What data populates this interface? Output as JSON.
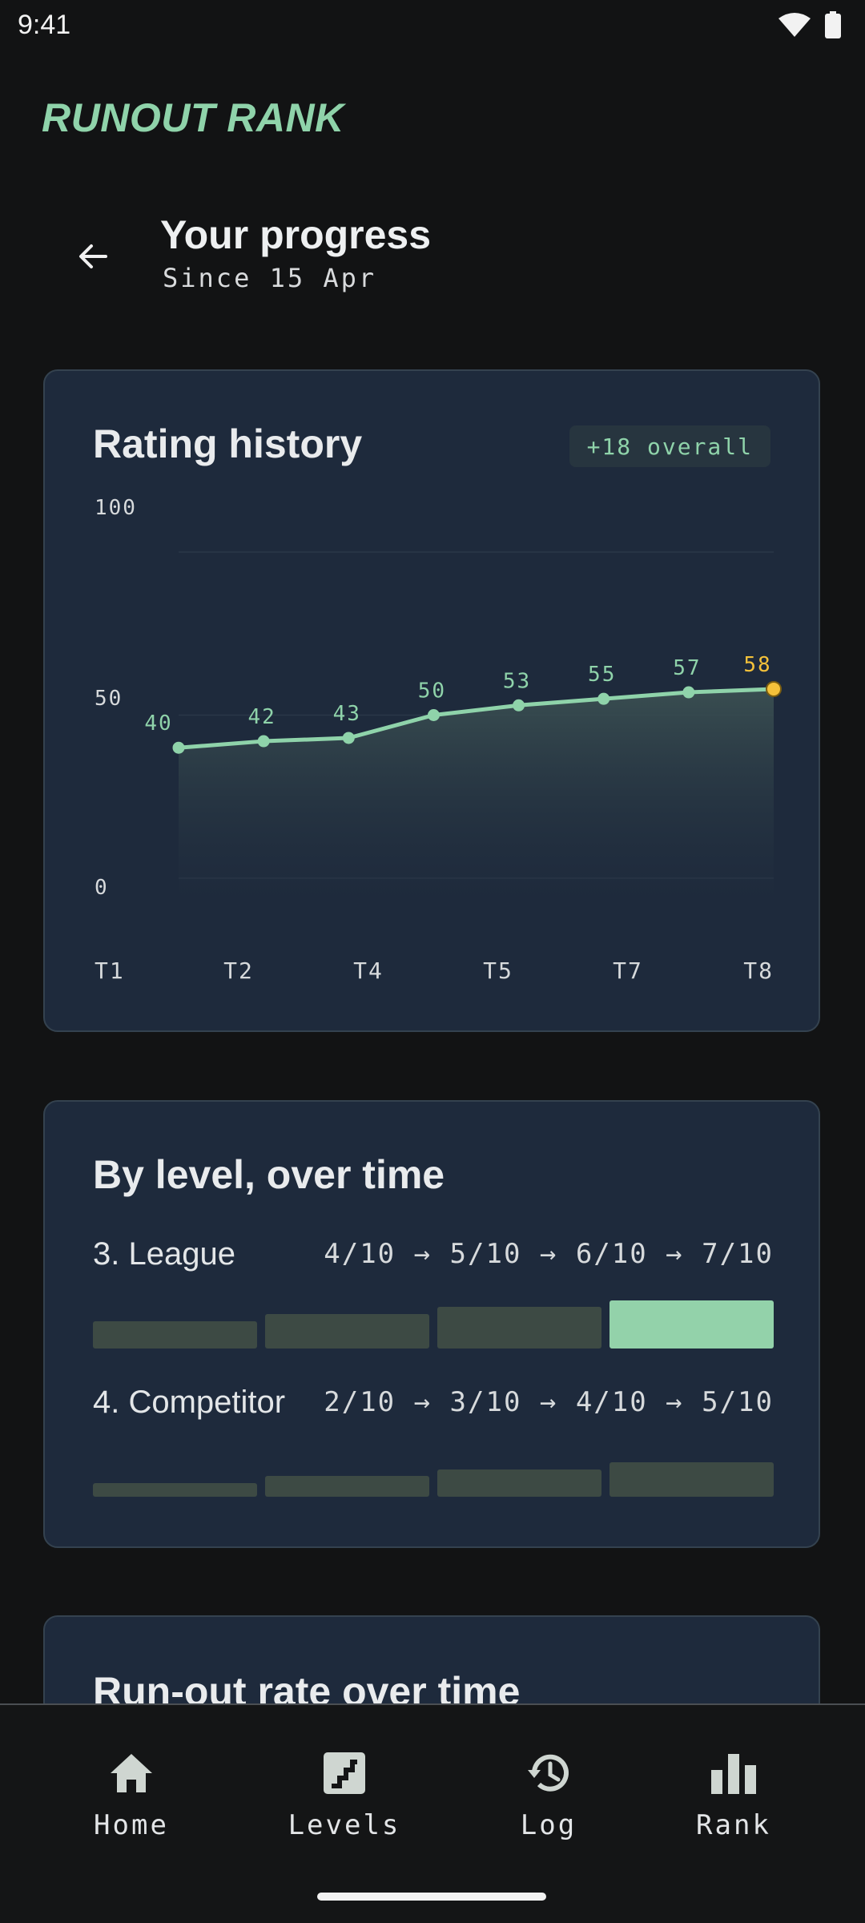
{
  "status": {
    "time": "9:41",
    "icons": [
      "wifi-icon",
      "battery-icon"
    ]
  },
  "app": {
    "brand": "RUNOUT RANK"
  },
  "header": {
    "title": "Your progress",
    "subtitle": "Since 15 Apr"
  },
  "rating_card": {
    "title": "Rating history",
    "badge": "+18 overall"
  },
  "chart_data": {
    "type": "line",
    "title": "Rating history",
    "y_ticks": [
      "100",
      "50",
      "0"
    ],
    "ylim": [
      0,
      100
    ],
    "x_tick_labels": [
      "T1",
      "T2",
      "T4",
      "T5",
      "T7",
      "T8"
    ],
    "series": [
      {
        "values": [
          40,
          42,
          43,
          50,
          53,
          55,
          57,
          58
        ]
      }
    ],
    "highlight_last": true,
    "colors": {
      "line": "#8fd3aa",
      "last_point": "#f4c13a",
      "label": "#8fd3aa"
    }
  },
  "levels_card": {
    "title": "By level, over time",
    "rows": [
      {
        "name": "3. League",
        "seq": "4/10  →  5/10  →  6/10  →  7/10",
        "values": [
          4,
          5,
          6,
          7
        ],
        "highlight_index": 3
      },
      {
        "name": "4. Competitor",
        "seq": "2/10  →  3/10  →  4/10  →  5/10",
        "values": [
          2,
          3,
          4,
          5
        ],
        "highlight_index": -1
      }
    ]
  },
  "runout_card": {
    "title": "Run-out rate over time"
  },
  "nav": {
    "items": [
      {
        "label": "Home",
        "icon": "home-icon"
      },
      {
        "label": "Levels",
        "icon": "levels-icon"
      },
      {
        "label": "Log",
        "icon": "history-icon"
      },
      {
        "label": "Rank",
        "icon": "bar-chart-icon"
      }
    ]
  },
  "colors": {
    "accent": "#8fd3aa",
    "highlight": "#f4c13a",
    "card": "#1e2a3c",
    "background": "#121314"
  }
}
